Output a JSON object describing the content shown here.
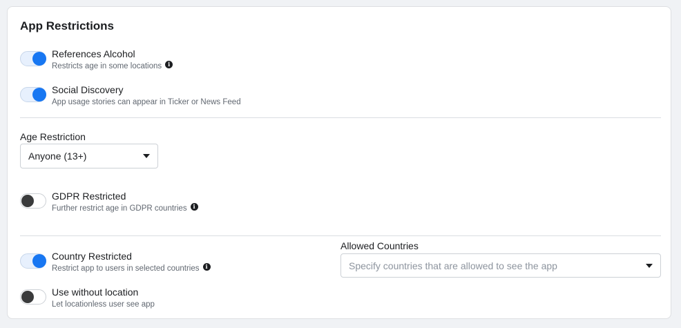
{
  "section": {
    "title": "App Restrictions"
  },
  "toggles": {
    "references_alcohol": {
      "label": "References Alcohol",
      "description": "Restricts age in some locations",
      "state": "on"
    },
    "social_discovery": {
      "label": "Social Discovery",
      "description": "App usage stories can appear in Ticker or News Feed",
      "state": "on"
    },
    "gdpr_restricted": {
      "label": "GDPR Restricted",
      "description": "Further restrict age in GDPR countries",
      "state": "off"
    },
    "country_restricted": {
      "label": "Country Restricted",
      "description": "Restrict app to users in selected countries",
      "state": "on"
    },
    "use_without_location": {
      "label": "Use without location",
      "description": "Let locationless user see app",
      "state": "off"
    }
  },
  "age_restriction": {
    "label": "Age Restriction",
    "selected": "Anyone (13+)"
  },
  "allowed_countries": {
    "label": "Allowed Countries",
    "placeholder": "Specify countries that are allowed to see the app"
  },
  "colors": {
    "accent": "#1877f2",
    "toggle_off_knob": "#3a3b3c",
    "divider": "#dadde1"
  },
  "icons": {
    "info": "info-icon",
    "dropdown": "caret-down-icon"
  }
}
